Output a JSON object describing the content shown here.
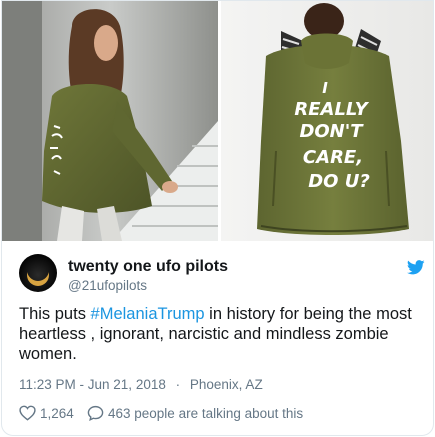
{
  "tweet": {
    "display_name": "twenty one ufo pilots",
    "handle": "@21ufopilots",
    "text_before": "This puts ",
    "hashtag": "#MelaniaTrump",
    "text_after": " in history for being the most heartless , ignorant, narcistic and mindless zombie women.",
    "time": "11:23 PM - Jun 21, 2018",
    "separator": "·",
    "location": "Phoenix, AZ",
    "like_count": "1,264",
    "talking_text": "463 people are talking about this"
  },
  "media": {
    "jacket_text": [
      "I",
      "REALLY",
      "DON'T",
      "CARE,",
      "DO U?"
    ]
  },
  "icons": {
    "bird": "twitter-bird-icon",
    "like": "heart-icon",
    "reply": "speech-bubble-icon"
  },
  "colors": {
    "link": "#1b95e0",
    "secondary_text": "#657786",
    "jacket": "#6b7336"
  }
}
